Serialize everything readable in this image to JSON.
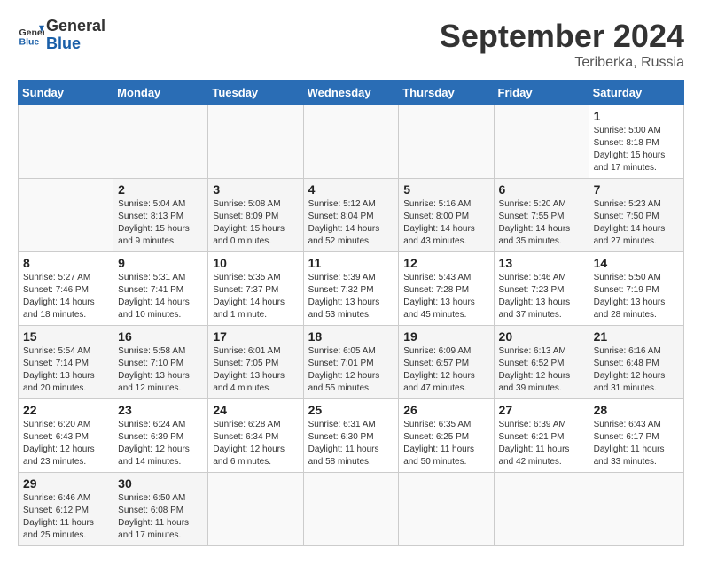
{
  "header": {
    "logo_text_general": "General",
    "logo_text_blue": "Blue",
    "month_title": "September 2024",
    "location": "Teriberka, Russia"
  },
  "calendar": {
    "days_of_week": [
      "Sunday",
      "Monday",
      "Tuesday",
      "Wednesday",
      "Thursday",
      "Friday",
      "Saturday"
    ],
    "weeks": [
      [
        {
          "day": "",
          "info": ""
        },
        {
          "day": "",
          "info": ""
        },
        {
          "day": "",
          "info": ""
        },
        {
          "day": "",
          "info": ""
        },
        {
          "day": "",
          "info": ""
        },
        {
          "day": "",
          "info": ""
        },
        {
          "day": "1",
          "info": "Sunrise: 5:00 AM\nSunset: 8:18 PM\nDaylight: 15 hours\nand 17 minutes."
        }
      ],
      [
        {
          "day": "",
          "info": ""
        },
        {
          "day": "2",
          "info": "Sunrise: 5:04 AM\nSunset: 8:13 PM\nDaylight: 15 hours\nand 9 minutes."
        },
        {
          "day": "3",
          "info": "Sunrise: 5:08 AM\nSunset: 8:09 PM\nDaylight: 15 hours\nand 0 minutes."
        },
        {
          "day": "4",
          "info": "Sunrise: 5:12 AM\nSunset: 8:04 PM\nDaylight: 14 hours\nand 52 minutes."
        },
        {
          "day": "5",
          "info": "Sunrise: 5:16 AM\nSunset: 8:00 PM\nDaylight: 14 hours\nand 43 minutes."
        },
        {
          "day": "6",
          "info": "Sunrise: 5:20 AM\nSunset: 7:55 PM\nDaylight: 14 hours\nand 35 minutes."
        },
        {
          "day": "7",
          "info": "Sunrise: 5:23 AM\nSunset: 7:50 PM\nDaylight: 14 hours\nand 27 minutes."
        }
      ],
      [
        {
          "day": "8",
          "info": "Sunrise: 5:27 AM\nSunset: 7:46 PM\nDaylight: 14 hours\nand 18 minutes."
        },
        {
          "day": "9",
          "info": "Sunrise: 5:31 AM\nSunset: 7:41 PM\nDaylight: 14 hours\nand 10 minutes."
        },
        {
          "day": "10",
          "info": "Sunrise: 5:35 AM\nSunset: 7:37 PM\nDaylight: 14 hours\nand 1 minute."
        },
        {
          "day": "11",
          "info": "Sunrise: 5:39 AM\nSunset: 7:32 PM\nDaylight: 13 hours\nand 53 minutes."
        },
        {
          "day": "12",
          "info": "Sunrise: 5:43 AM\nSunset: 7:28 PM\nDaylight: 13 hours\nand 45 minutes."
        },
        {
          "day": "13",
          "info": "Sunrise: 5:46 AM\nSunset: 7:23 PM\nDaylight: 13 hours\nand 37 minutes."
        },
        {
          "day": "14",
          "info": "Sunrise: 5:50 AM\nSunset: 7:19 PM\nDaylight: 13 hours\nand 28 minutes."
        }
      ],
      [
        {
          "day": "15",
          "info": "Sunrise: 5:54 AM\nSunset: 7:14 PM\nDaylight: 13 hours\nand 20 minutes."
        },
        {
          "day": "16",
          "info": "Sunrise: 5:58 AM\nSunset: 7:10 PM\nDaylight: 13 hours\nand 12 minutes."
        },
        {
          "day": "17",
          "info": "Sunrise: 6:01 AM\nSunset: 7:05 PM\nDaylight: 13 hours\nand 4 minutes."
        },
        {
          "day": "18",
          "info": "Sunrise: 6:05 AM\nSunset: 7:01 PM\nDaylight: 12 hours\nand 55 minutes."
        },
        {
          "day": "19",
          "info": "Sunrise: 6:09 AM\nSunset: 6:57 PM\nDaylight: 12 hours\nand 47 minutes."
        },
        {
          "day": "20",
          "info": "Sunrise: 6:13 AM\nSunset: 6:52 PM\nDaylight: 12 hours\nand 39 minutes."
        },
        {
          "day": "21",
          "info": "Sunrise: 6:16 AM\nSunset: 6:48 PM\nDaylight: 12 hours\nand 31 minutes."
        }
      ],
      [
        {
          "day": "22",
          "info": "Sunrise: 6:20 AM\nSunset: 6:43 PM\nDaylight: 12 hours\nand 23 minutes."
        },
        {
          "day": "23",
          "info": "Sunrise: 6:24 AM\nSunset: 6:39 PM\nDaylight: 12 hours\nand 14 minutes."
        },
        {
          "day": "24",
          "info": "Sunrise: 6:28 AM\nSunset: 6:34 PM\nDaylight: 12 hours\nand 6 minutes."
        },
        {
          "day": "25",
          "info": "Sunrise: 6:31 AM\nSunset: 6:30 PM\nDaylight: 11 hours\nand 58 minutes."
        },
        {
          "day": "26",
          "info": "Sunrise: 6:35 AM\nSunset: 6:25 PM\nDaylight: 11 hours\nand 50 minutes."
        },
        {
          "day": "27",
          "info": "Sunrise: 6:39 AM\nSunset: 6:21 PM\nDaylight: 11 hours\nand 42 minutes."
        },
        {
          "day": "28",
          "info": "Sunrise: 6:43 AM\nSunset: 6:17 PM\nDaylight: 11 hours\nand 33 minutes."
        }
      ],
      [
        {
          "day": "29",
          "info": "Sunrise: 6:46 AM\nSunset: 6:12 PM\nDaylight: 11 hours\nand 25 minutes."
        },
        {
          "day": "30",
          "info": "Sunrise: 6:50 AM\nSunset: 6:08 PM\nDaylight: 11 hours\nand 17 minutes."
        },
        {
          "day": "",
          "info": ""
        },
        {
          "day": "",
          "info": ""
        },
        {
          "day": "",
          "info": ""
        },
        {
          "day": "",
          "info": ""
        },
        {
          "day": "",
          "info": ""
        }
      ]
    ]
  }
}
